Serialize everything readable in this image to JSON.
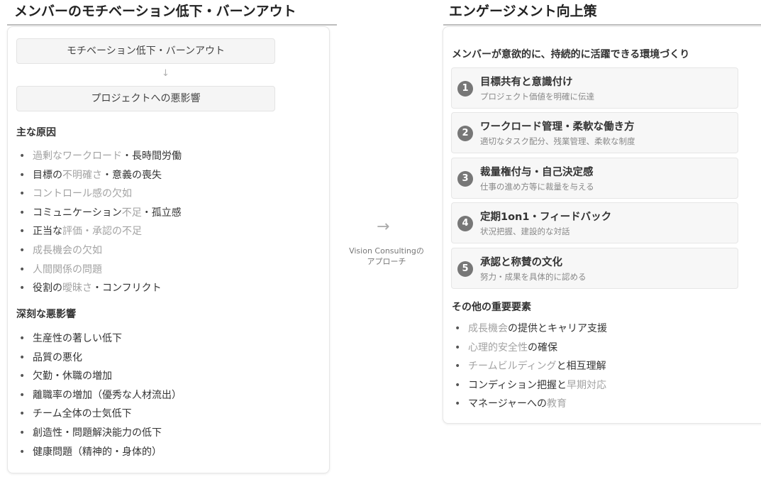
{
  "left": {
    "title": "メンバーのモチベーション低下・バーンアウト",
    "flow": [
      "モチベーション低下・バーンアウト",
      "↓",
      "プロジェクトへの悪影響"
    ],
    "causes_heading": "主な原因",
    "causes": [
      [
        {
          "t": "過剰なワークロード",
          "g": true
        },
        {
          "t": "・長時間労働",
          "g": false
        }
      ],
      [
        {
          "t": "目標の",
          "g": false
        },
        {
          "t": "不明確さ",
          "g": true
        },
        {
          "t": "・意義の喪失",
          "g": false
        }
      ],
      [
        {
          "t": "コントロール感の欠如",
          "g": true
        }
      ],
      [
        {
          "t": "コミュニケーション",
          "g": false
        },
        {
          "t": "不足",
          "g": true
        },
        {
          "t": "・孤立感",
          "g": false
        }
      ],
      [
        {
          "t": "正当な",
          "g": false
        },
        {
          "t": "評価・承認の不足",
          "g": true
        }
      ],
      [
        {
          "t": "成長機会の欠如",
          "g": true
        }
      ],
      [
        {
          "t": "人間関係の問題",
          "g": true
        }
      ],
      [
        {
          "t": "役割の",
          "g": false
        },
        {
          "t": "曖昧さ",
          "g": true
        },
        {
          "t": "・コンフリクト",
          "g": false
        }
      ]
    ],
    "impact_heading": "深刻な悪影響",
    "impacts": [
      "生産性の著しい低下",
      "品質の悪化",
      "欠勤・休職の増加",
      "離職率の増加（優秀な人材流出）",
      "チーム全体の士気低下",
      "創造性・問題解決能力の低下",
      "健康問題（精神的・身体的）"
    ]
  },
  "middle": {
    "arrow": "→",
    "caption_line1": "Vision Consultingの",
    "caption_line2": "アプローチ"
  },
  "right": {
    "title": "エンゲージメント向上策",
    "subtitle": "メンバーが意欲的に、持続的に活躍できる環境づくり",
    "strategies": [
      {
        "num": "1",
        "title": "目標共有と意識付け",
        "desc": "プロジェクト価値を明確に伝達"
      },
      {
        "num": "2",
        "title": "ワークロード管理・柔軟な働き方",
        "desc": "適切なタスク配分、残業管理、柔軟な制度"
      },
      {
        "num": "3",
        "title": "裁量権付与・自己決定感",
        "desc": "仕事の進め方等に裁量を与える"
      },
      {
        "num": "4",
        "title": "定期1on1・フィードバック",
        "desc": "状況把握、建設的な対話"
      },
      {
        "num": "5",
        "title": "承認と称賛の文化",
        "desc": "努力・成果を具体的に認める"
      }
    ],
    "other_heading": "その他の重要要素",
    "others": [
      [
        {
          "t": "成長機会",
          "g": true
        },
        {
          "t": "の提供とキャリア支援",
          "g": false
        }
      ],
      [
        {
          "t": "心理的安全性",
          "g": true
        },
        {
          "t": "の確保",
          "g": false
        }
      ],
      [
        {
          "t": "チームビルディング",
          "g": true
        },
        {
          "t": "と相互理解",
          "g": false
        }
      ],
      [
        {
          "t": "コンディション把握と",
          "g": false
        },
        {
          "t": "早期対応",
          "g": true
        }
      ],
      [
        {
          "t": "マネージャーへの",
          "g": false
        },
        {
          "t": "教育",
          "g": true
        }
      ]
    ]
  },
  "colors": {
    "accent_gray": "#a3a3a3",
    "text": "#333333",
    "badge": "#777777"
  }
}
